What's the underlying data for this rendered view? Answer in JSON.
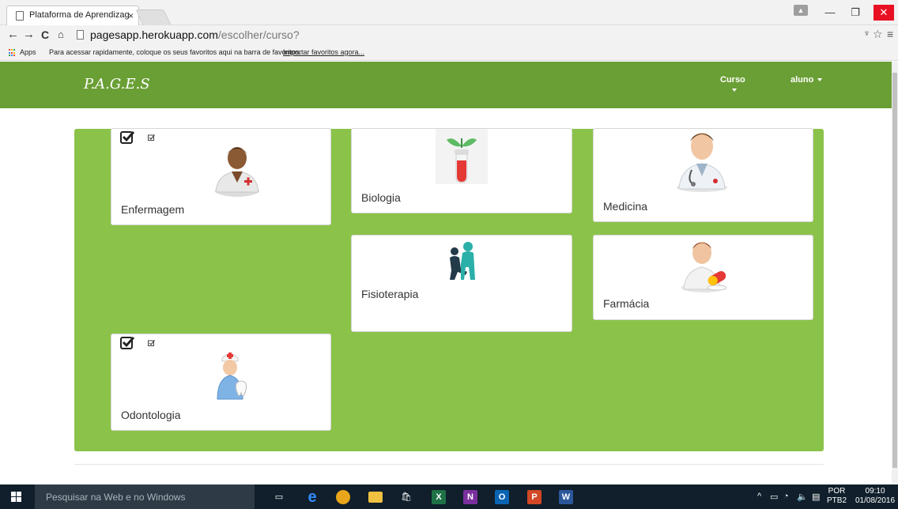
{
  "browser": {
    "tab_title": "Plataforma de Aprendizag",
    "tab_close": "×",
    "url_host": "pagesapp.herokuapp.com",
    "url_path": "/escolher/curso?",
    "bookmarks_apps": "Apps",
    "bookmarks_message": "Para acessar rapidamente, coloque os seus favoritos aqui na barra de favoritos.",
    "bookmarks_link": "Importar favoritos agora..."
  },
  "navbar": {
    "brand": "P.A.G.E.S",
    "curso": "Curso",
    "aluno": "aluno"
  },
  "courses": {
    "enfermagem": "Enfermagem",
    "biologia": "Biologia",
    "medicina": "Medicina",
    "fisioterapia": "Fisioterapia",
    "farmacia": "Farmácia",
    "odontologia": "Odontologia"
  },
  "taskbar": {
    "search_placeholder": "Pesquisar na Web e no Windows",
    "lang_top": "POR",
    "lang_bottom": "PTB2",
    "time": "09:10",
    "date": "01/08/2016",
    "excel": "X",
    "onenote": "N",
    "outlook": "O",
    "powerpoint": "P",
    "word": "W"
  },
  "colors": {
    "navbar": "#6a9f35",
    "panel": "#8bc34a",
    "taskbar": "#101f2b"
  }
}
